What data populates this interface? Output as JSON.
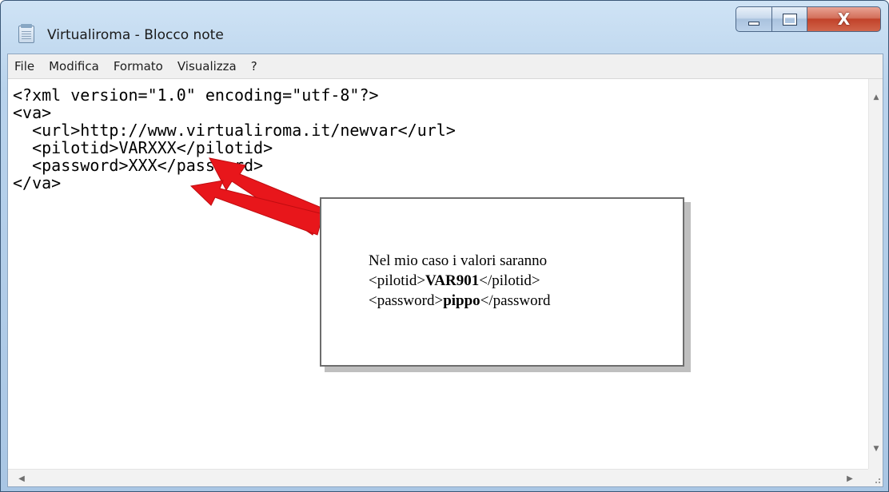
{
  "window": {
    "title": "Virtualiroma - Blocco note",
    "buttons": {
      "minimize": "minimize",
      "maximize": "maximize",
      "close": "X"
    }
  },
  "menu": {
    "items": [
      "File",
      "Modifica",
      "Formato",
      "Visualizza",
      "?"
    ]
  },
  "editor": {
    "lines": [
      "<?xml version=\"1.0\" encoding=\"utf-8\"?>",
      "<va>",
      "  <url>http://www.virtualiroma.it/newvar</url>",
      "  <pilotid>VARXXX</pilotid>",
      "  <password>XXX</password>",
      "</va>"
    ]
  },
  "callout": {
    "line1": "Nel mio caso i valori saranno",
    "line2_open": "<pilotid>",
    "line2_value": "VAR901",
    "line2_close": "</pilotid>",
    "line3_open": "<password>",
    "line3_value": "pippo",
    "line3_close": "</password"
  },
  "icons": {
    "app": "notepad-icon",
    "scroll_up": "▲",
    "scroll_down": "▼",
    "scroll_left": "◀",
    "scroll_right": "▶"
  },
  "colors": {
    "arrow": "#e8161b",
    "close_button": "#c8442c",
    "frame": "#b9d3ec"
  }
}
